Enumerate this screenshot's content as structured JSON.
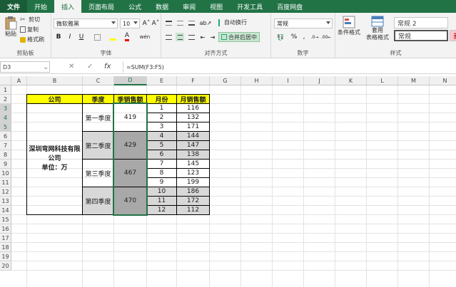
{
  "menu": {
    "tabs": [
      "文件",
      "开始",
      "插入",
      "页面布局",
      "公式",
      "数据",
      "审阅",
      "视图",
      "开发工具",
      "百度网盘"
    ],
    "active_tab": "插入"
  },
  "ribbon": {
    "clipboard": {
      "label": "剪贴板",
      "paste": "粘贴",
      "cut": "剪切",
      "copy": "复制",
      "painter": "格式刷"
    },
    "font": {
      "label": "字体",
      "font_name": "微软雅黑",
      "font_size": "10",
      "grow": "A˄",
      "shrink": "A˅",
      "bold": "B",
      "italic": "I",
      "underline": "U",
      "phonetic": "wén"
    },
    "alignment": {
      "label": "对齐方式",
      "wrap": "自动换行",
      "merge": "合并后居中"
    },
    "number": {
      "label": "数字",
      "format": "常规",
      "percent": "%",
      "comma": ","
    },
    "styles": {
      "label": "样式",
      "conditional": "条件格式",
      "table": "套用",
      "table2": "表格格式",
      "style1": "常规 2",
      "style2": "常规",
      "style3": "差"
    }
  },
  "formula_bar": {
    "name_box": "D3",
    "cancel": "✕",
    "enter": "✓",
    "fx": "fx",
    "formula": "=SUM(F3:F5)"
  },
  "columns": [
    "A",
    "B",
    "C",
    "D",
    "E",
    "F",
    "G",
    "H",
    "I",
    "J",
    "K",
    "L",
    "M",
    "N"
  ],
  "rows": [
    "1",
    "2",
    "3",
    "4",
    "5",
    "6",
    "7",
    "8",
    "9",
    "10",
    "11",
    "12",
    "13",
    "14",
    "15",
    "16",
    "17",
    "18",
    "19",
    "20"
  ],
  "table": {
    "headers": {
      "company": "公司",
      "quarter": "季度",
      "quarter_sales": "季销售额",
      "month": "月份",
      "month_sales": "月销售额"
    },
    "company_line1": "深圳弯网科技有限",
    "company_line2": "公司",
    "company_line3": "单位：万",
    "quarters": [
      {
        "name": "第一季度",
        "total": "419",
        "months": [
          {
            "m": "1",
            "v": "116"
          },
          {
            "m": "2",
            "v": "132"
          },
          {
            "m": "3",
            "v": "171"
          }
        ]
      },
      {
        "name": "第二季度",
        "total": "429",
        "months": [
          {
            "m": "4",
            "v": "144"
          },
          {
            "m": "5",
            "v": "147"
          },
          {
            "m": "6",
            "v": "138"
          }
        ]
      },
      {
        "name": "第三季度",
        "total": "467",
        "months": [
          {
            "m": "7",
            "v": "145"
          },
          {
            "m": "8",
            "v": "123"
          },
          {
            "m": "9",
            "v": "199"
          }
        ]
      },
      {
        "name": "第四季度",
        "total": "470",
        "months": [
          {
            "m": "10",
            "v": "186"
          },
          {
            "m": "11",
            "v": "172"
          },
          {
            "m": "12",
            "v": "112"
          }
        ]
      }
    ]
  }
}
